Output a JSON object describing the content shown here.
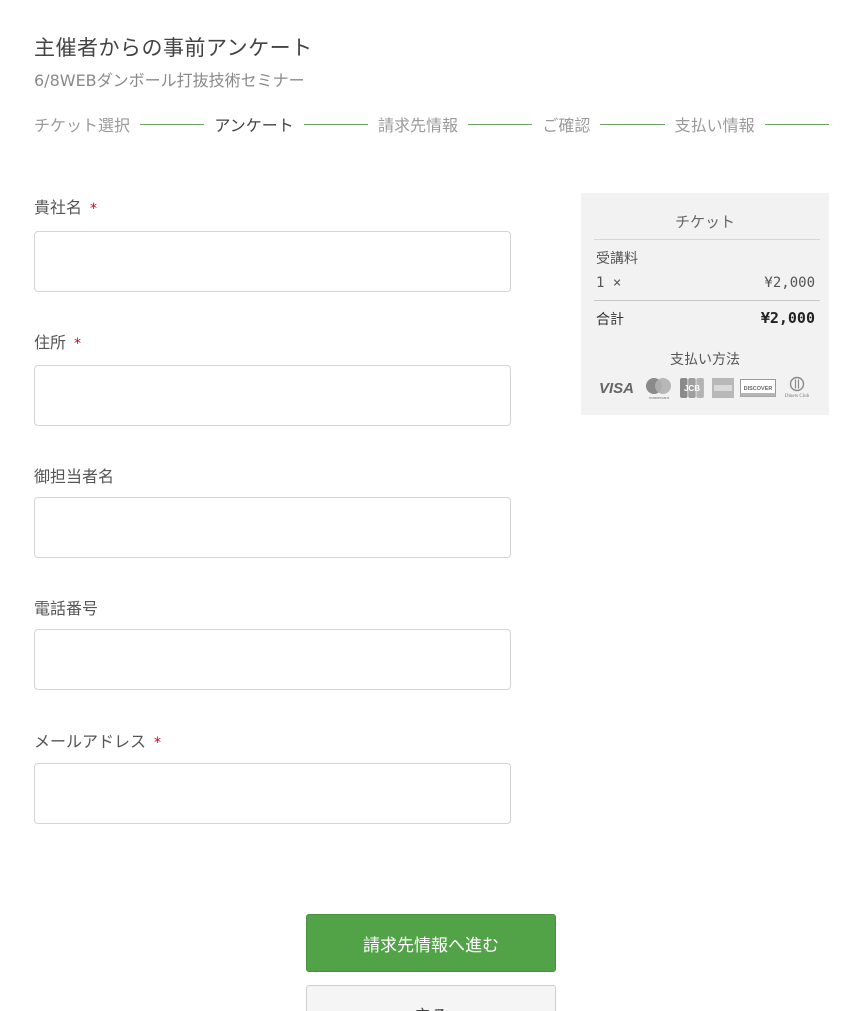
{
  "header": {
    "title": "主催者からの事前アンケート",
    "subtitle": "6/8WEBダンボール打抜技術セミナー"
  },
  "steps": [
    {
      "label": "チケット選択",
      "active": false
    },
    {
      "label": "アンケート",
      "active": true
    },
    {
      "label": "請求先情報",
      "active": false
    },
    {
      "label": "ご確認",
      "active": false
    },
    {
      "label": "支払い情報",
      "active": false
    }
  ],
  "colors": {
    "accent_green": "#52a347",
    "step_line": "#6aa163",
    "required_mark": "#d0021b"
  },
  "form": {
    "required_mark": "*",
    "fields": [
      {
        "label": "貴社名",
        "required": true,
        "value": "",
        "placeholder": ""
      },
      {
        "label": "住所",
        "required": true,
        "value": "",
        "placeholder": ""
      },
      {
        "label": "御担当者名",
        "required": false,
        "value": "",
        "placeholder": ""
      },
      {
        "label": "電話番号",
        "required": false,
        "value": "",
        "placeholder": ""
      },
      {
        "label": "メールアドレス",
        "required": true,
        "value": "",
        "placeholder": ""
      }
    ]
  },
  "summary": {
    "heading": "チケット",
    "item_name": "受講料",
    "quantity": "1 ×",
    "price": "¥2,000",
    "total_label": "合計",
    "total": "¥2,000",
    "payment_label": "支払い方法",
    "payment_icons": [
      "visa-icon",
      "mastercard-icon",
      "jcb-icon",
      "amex-icon",
      "discover-icon",
      "diners-club-icon"
    ],
    "card_labels": {
      "visa": "VISA",
      "mastercard": "mastercard",
      "jcb": "JCB",
      "discover": "DISCOVER",
      "diners": "Diners Club"
    }
  },
  "buttons": {
    "next": "請求先情報へ進む",
    "back": "戻る"
  }
}
